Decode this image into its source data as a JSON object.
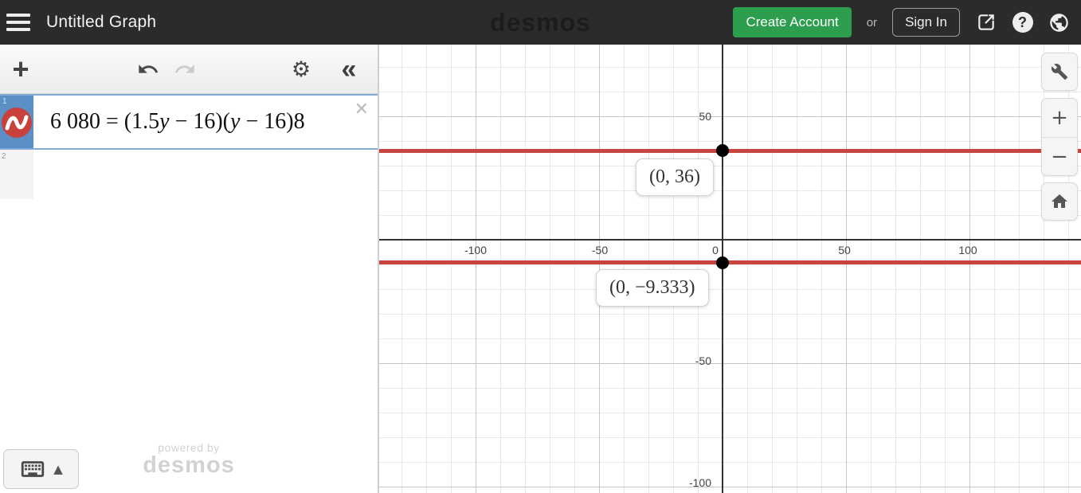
{
  "header": {
    "title": "Untitled Graph",
    "logo": "desmos",
    "create_account_label": "Create Account",
    "or_label": "or",
    "sign_in_label": "Sign In"
  },
  "icons": {
    "add": "+",
    "gear": "⚙",
    "collapse": "«",
    "close": "✕",
    "keyboard_toggle": "▲",
    "zoom_in": "+",
    "zoom_out": "−"
  },
  "expressions": {
    "row1": {
      "number": "1",
      "equation_full": "6 080 = (1.5y − 16)(y − 16)8",
      "parts": [
        "6 080 = (1.5",
        "y",
        " − 16)(",
        "y",
        " − 16)8"
      ]
    },
    "row2": {
      "number": "2"
    }
  },
  "watermark": {
    "line1": "powered by",
    "line2": "desmos"
  },
  "graph": {
    "x_ticks": [
      "-100",
      "-50",
      "0",
      "50",
      "100"
    ],
    "y_ticks": [
      "50",
      "-50",
      "-100"
    ],
    "lines": [
      {
        "y": 36,
        "point": [
          0,
          36
        ],
        "point_label": "(0, 36)",
        "color": "#c74440"
      },
      {
        "y": -9.333,
        "point": [
          0,
          -9.333
        ],
        "point_label": "(0, −9.333)",
        "color": "#c74440"
      }
    ],
    "colors": {
      "curve_red": "#c74440",
      "axis": "#333333",
      "grid_major": "#c6c6c6",
      "grid_minor": "#e8e8e8",
      "selection_blue": "#5b8fc6",
      "accent_green": "#2c9e4e"
    }
  }
}
